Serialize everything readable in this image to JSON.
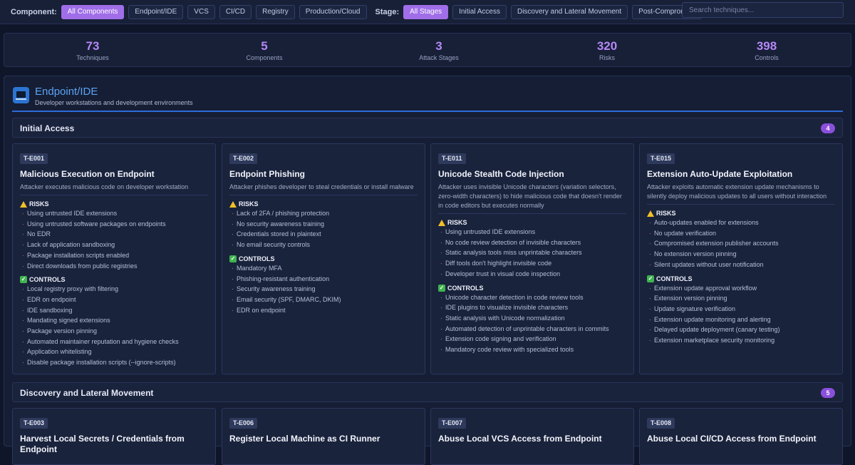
{
  "filters": {
    "component_label": "Component:",
    "components": [
      "All Components",
      "Endpoint/IDE",
      "VCS",
      "CI/CD",
      "Registry",
      "Production/Cloud"
    ],
    "stage_label": "Stage:",
    "stages": [
      "All Stages",
      "Initial Access",
      "Discovery and Lateral Movement",
      "Post-Compromise"
    ],
    "search_placeholder": "Search techniques..."
  },
  "stats": [
    {
      "value": "73",
      "label": "Techniques"
    },
    {
      "value": "5",
      "label": "Components"
    },
    {
      "value": "3",
      "label": "Attack Stages"
    },
    {
      "value": "320",
      "label": "Risks"
    },
    {
      "value": "398",
      "label": "Controls"
    }
  ],
  "component": {
    "icon": "laptop-icon",
    "title": "Endpoint/IDE",
    "subtitle": "Developer workstations and development environments"
  },
  "labels": {
    "risks": "RISKS",
    "controls": "CONTROLS"
  },
  "stages": [
    {
      "name": "Initial Access",
      "count": "4",
      "techniques": [
        {
          "id": "T-E001",
          "title": "Malicious Execution on Endpoint",
          "description": "Attacker executes malicious code on developer workstation",
          "risks": [
            "Using untrusted IDE extensions",
            "Using untrusted software packages on endpoints",
            "No EDR",
            "Lack of application sandboxing",
            "Package installation scripts enabled",
            "Direct downloads from public registries"
          ],
          "controls": [
            "Local registry proxy with filtering",
            "EDR on endpoint",
            "IDE sandboxing",
            "Mandating signed extensions",
            "Package version pinning",
            "Automated maintainer reputation and hygiene checks",
            "Application whitelisting",
            "Disable package installation scripts (--ignore-scripts)"
          ]
        },
        {
          "id": "T-E002",
          "title": "Endpoint Phishing",
          "description": "Attacker phishes developer to steal credentials or install malware",
          "risks": [
            "Lack of 2FA / phishing protection",
            "No security awareness training",
            "Credentials stored in plaintext",
            "No email security controls"
          ],
          "controls": [
            "Mandatory MFA",
            "Phishing-resistant authentication",
            "Security awareness training",
            "Email security (SPF, DMARC, DKIM)",
            "EDR on endpoint"
          ]
        },
        {
          "id": "T-E011",
          "title": "Unicode Stealth Code Injection",
          "description": "Attacker uses invisible Unicode characters (variation selectors, zero-width characters) to hide malicious code that doesn't render in code editors but executes normally",
          "risks": [
            "Using untrusted IDE extensions",
            "No code review detection of invisible characters",
            "Static analysis tools miss unprintable characters",
            "Diff tools don't highlight invisible code",
            "Developer trust in visual code inspection"
          ],
          "controls": [
            "Unicode character detection in code review tools",
            "IDE plugins to visualize invisible characters",
            "Static analysis with Unicode normalization",
            "Automated detection of unprintable characters in commits",
            "Extension code signing and verification",
            "Mandatory code review with specialized tools"
          ]
        },
        {
          "id": "T-E015",
          "title": "Extension Auto-Update Exploitation",
          "description": "Attacker exploits automatic extension update mechanisms to silently deploy malicious updates to all users without interaction",
          "risks": [
            "Auto-updates enabled for extensions",
            "No update verification",
            "Compromised extension publisher accounts",
            "No extension version pinning",
            "Silent updates without user notification"
          ],
          "controls": [
            "Extension update approval workflow",
            "Extension version pinning",
            "Update signature verification",
            "Extension update monitoring and alerting",
            "Delayed update deployment (canary testing)",
            "Extension marketplace security monitoring"
          ]
        }
      ]
    },
    {
      "name": "Discovery and Lateral Movement",
      "count": "5",
      "techniques": [
        {
          "id": "T-E003",
          "title": "Harvest Local Secrets / Credentials from Endpoint"
        },
        {
          "id": "T-E006",
          "title": "Register Local Machine as CI Runner"
        },
        {
          "id": "T-E007",
          "title": "Abuse Local VCS Access from Endpoint"
        },
        {
          "id": "T-E008",
          "title": "Abuse Local CI/CD Access from Endpoint"
        }
      ]
    }
  ]
}
